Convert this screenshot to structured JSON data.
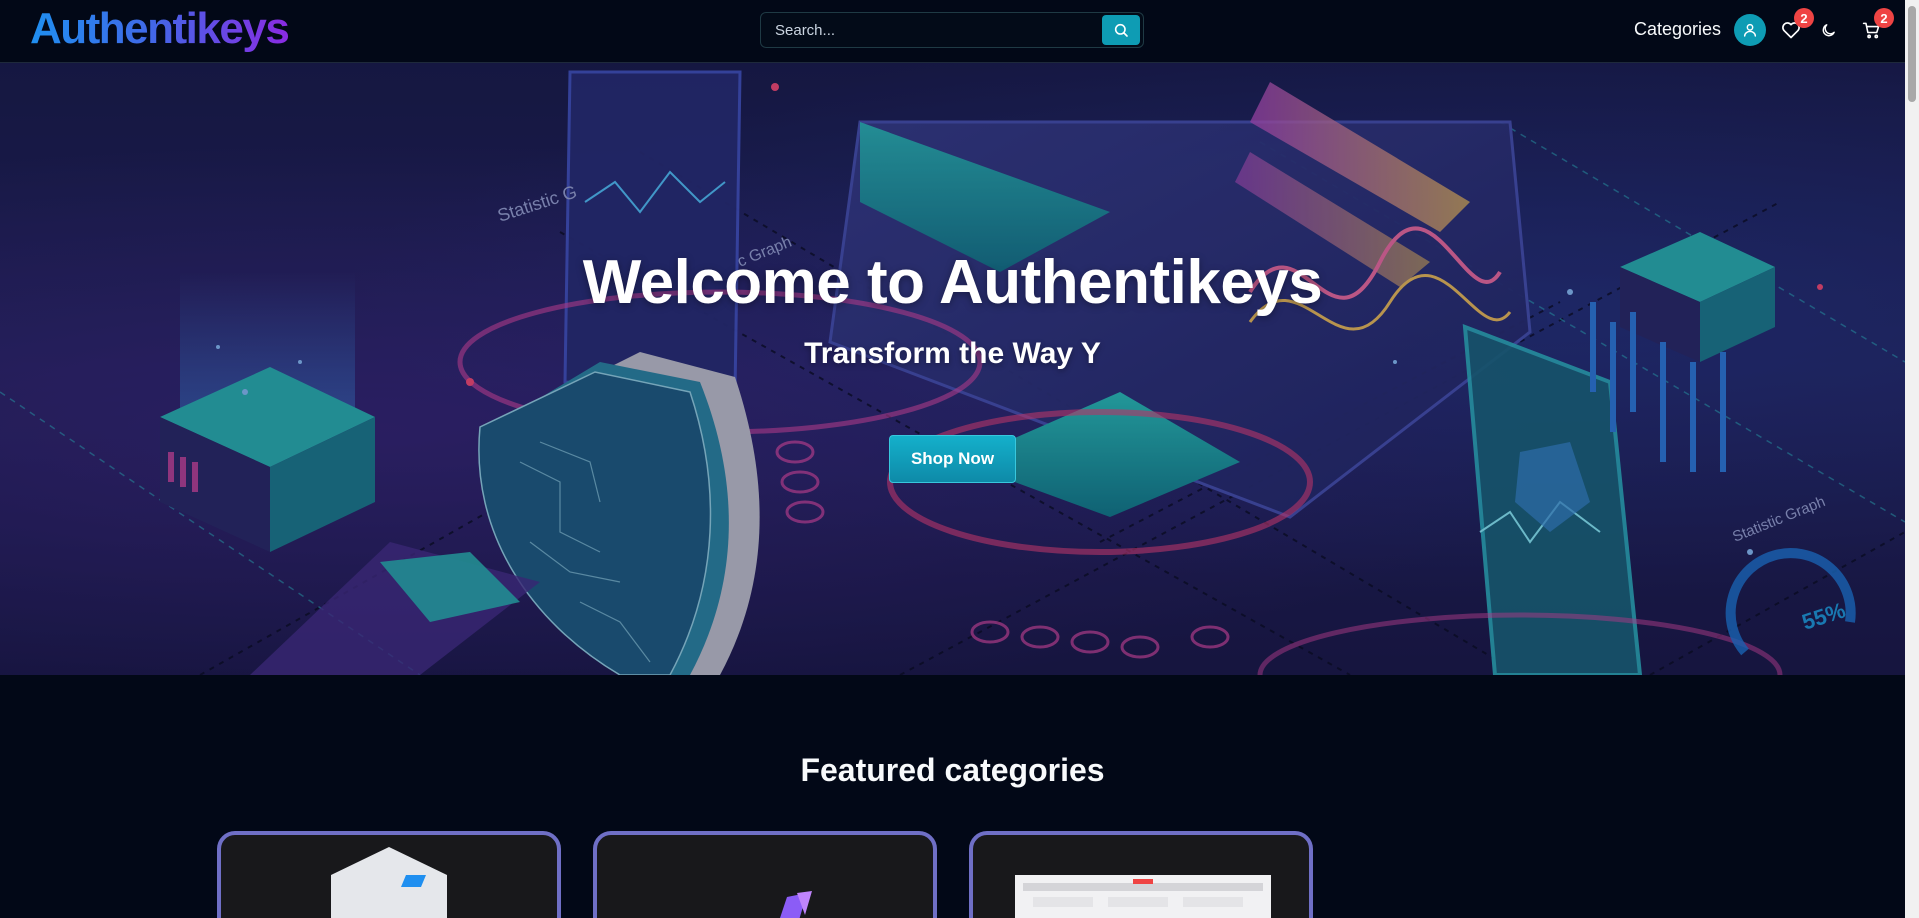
{
  "header": {
    "logo_text": "Authentikeys",
    "search": {
      "placeholder": "Search...",
      "value": ""
    },
    "nav_categories_label": "Categories",
    "wishlist_count": "2",
    "cart_count": "2",
    "accent_color": "#0e9cb4",
    "badge_color": "#ef4444"
  },
  "hero": {
    "title": "Welcome to Authentikeys",
    "subtitle": "Transform the Way Y",
    "cta_label": "Shop Now",
    "art_labels": {
      "stat_graph_left": "Statistic G",
      "stat_graph_mid": "c Graph",
      "stat_graph_right": "Statistic Graph",
      "gauge_percent": "55%"
    }
  },
  "featured": {
    "title": "Featured categories"
  },
  "icons": [
    "search-icon",
    "user-icon",
    "heart-icon",
    "moon-icon",
    "cart-icon"
  ]
}
